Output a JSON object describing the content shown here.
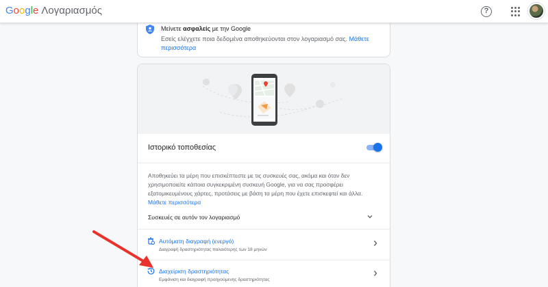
{
  "header": {
    "brand_letters": [
      "G",
      "o",
      "o",
      "g",
      "l",
      "e"
    ],
    "brand_colors": [
      "#4285f4",
      "#ea4335",
      "#fbbc05",
      "#4285f4",
      "#34a853",
      "#ea4335"
    ],
    "product": "Λογαριασμός",
    "help_glyph": "?"
  },
  "security_card": {
    "title_prefix": "Μείνετε ",
    "title_bold": "ασφαλείς",
    "title_suffix": " με την Google",
    "description": "Εσείς ελέγχετε ποια δεδομένα αποθηκεύονται στον λογαριασμό σας. ",
    "link": "Μάθετε περισσότερα"
  },
  "location_card": {
    "title": "Ιστορικό τοποθεσίας",
    "toggle_on": true,
    "description": "Αποθηκεύει τα μέρη που επισκέπτεστε με τις συσκευές σας, ακόμα και όταν δεν χρησιμοποιείτε κάποια συγκεκριμένη συσκευή Google, για να σας προσφέρει εξατομικευμένους χάρτες, προτάσεις με βάση τα μέρη που έχετε επισκεφτεί και άλλα.",
    "link": "Μάθετε περισσότερα",
    "devices_label": "Συσκευές σε αυτόν τον λογαριασμό",
    "items": [
      {
        "label": "Αυτόματη διαγραφή (ενεργό)",
        "sub": "Διαγραφή δραστηριότητας παλαιότερης των 18 μηνών",
        "icon": "auto-delete-icon"
      },
      {
        "label": "Διαχείριση δραστηριότητας",
        "sub": "Εμφάνιση και διαγραφή προηγούμενης δραστηριότητας",
        "icon": "history-icon"
      }
    ]
  },
  "colors": {
    "accent": "#1a73e8",
    "annotation_arrow": "#e8322b"
  }
}
